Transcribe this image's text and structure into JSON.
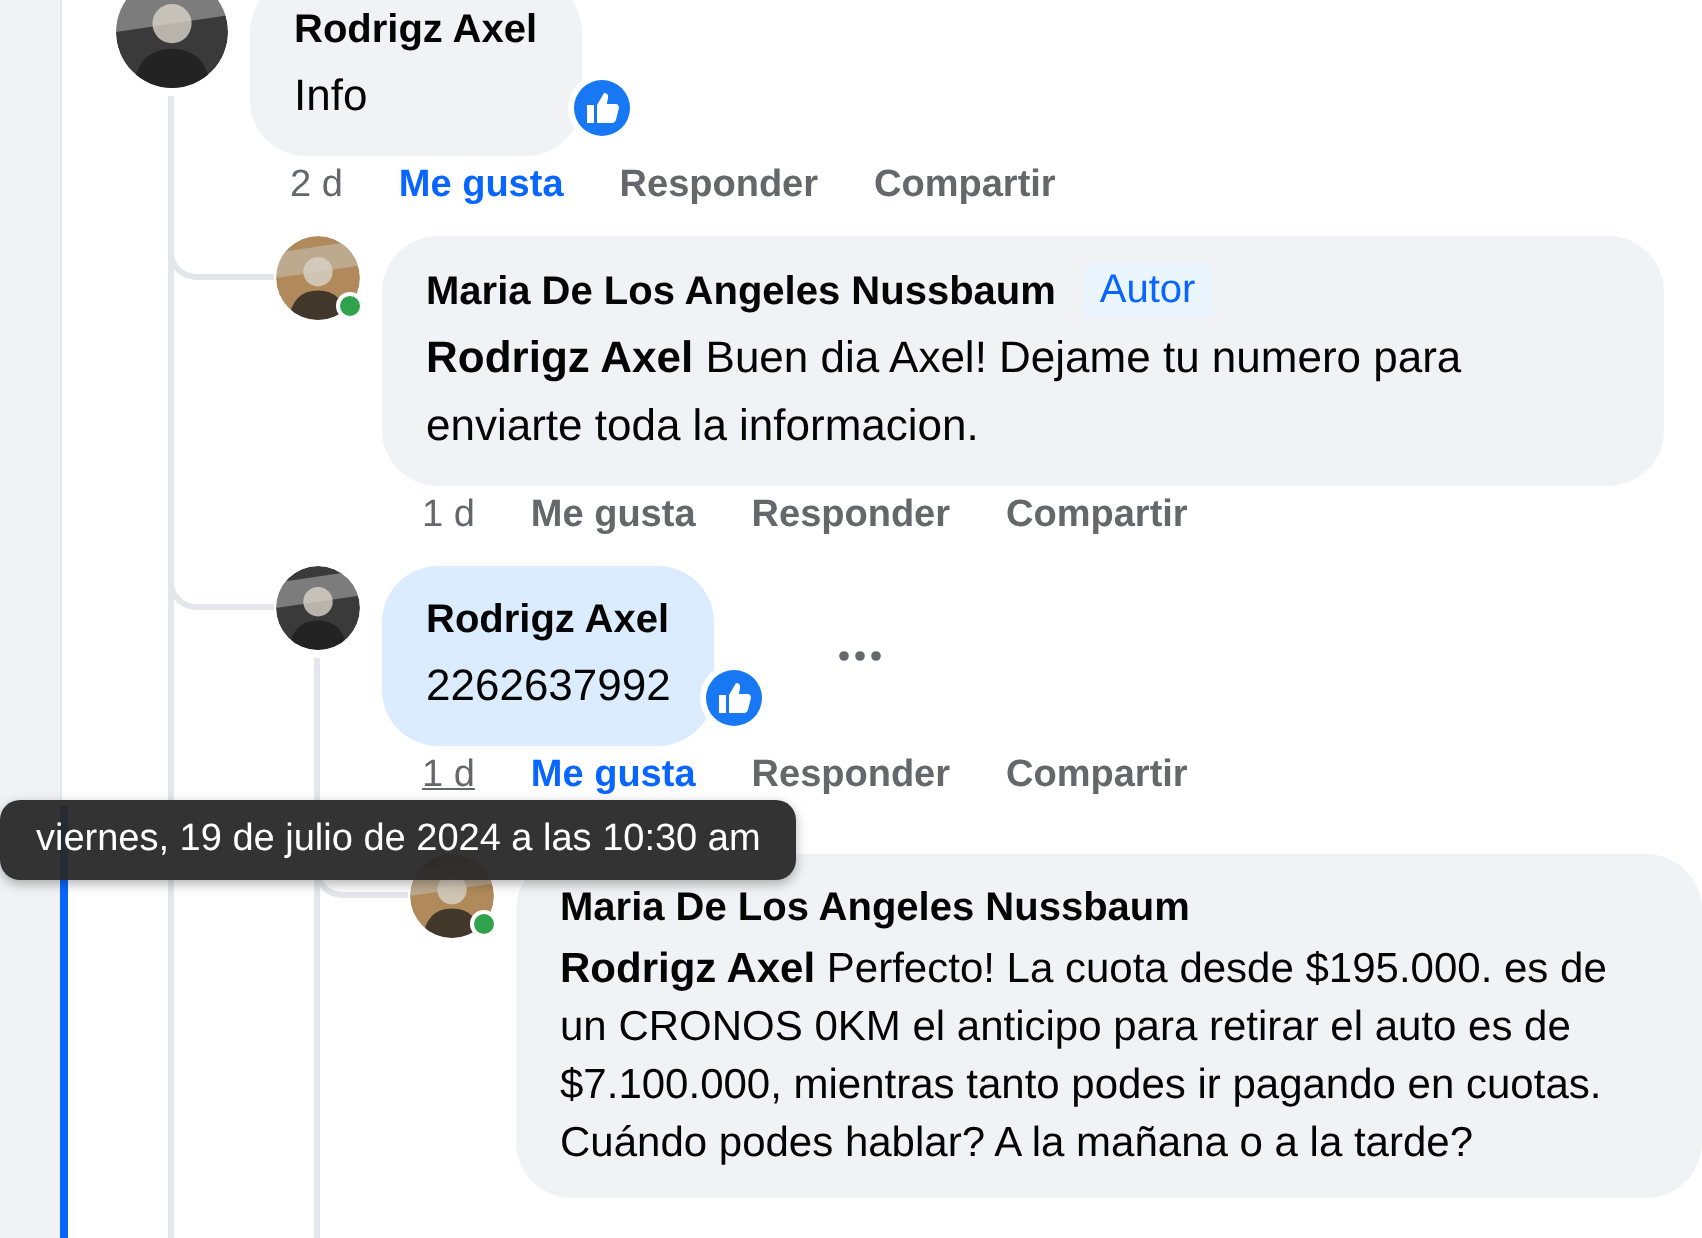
{
  "comments": [
    {
      "author": "Rodrigz Axel",
      "color": "#3a3a3a",
      "online": false,
      "highlighted": false,
      "text": "Info",
      "like_reaction": true,
      "menu": false,
      "time": "2 d",
      "time_hovered": false,
      "actions": [
        {
          "label": "Me gusta",
          "selected": true
        },
        {
          "label": "Responder",
          "selected": false
        },
        {
          "label": "Compartir",
          "selected": false
        }
      ],
      "replies": [
        {
          "author": "Maria De Los Angeles Nussbaum",
          "badge": "Autor",
          "color": "#b08a5a",
          "online": true,
          "highlighted": false,
          "text": "**Rodrigz Axel** Buen dia Axel! Dejame tu numero para enviarte toda la informacion.",
          "like_reaction": false,
          "menu": false,
          "time": "1 d",
          "time_hovered": false,
          "actions": [
            {
              "label": "Me gusta",
              "selected": false
            },
            {
              "label": "Responder",
              "selected": false
            },
            {
              "label": "Compartir",
              "selected": false
            }
          ]
        },
        {
          "author": "Rodrigz Axel",
          "color": "#3a3a3a",
          "online": false,
          "highlighted": true,
          "text": "2262637992",
          "like_reaction": true,
          "menu": true,
          "time": "1 d",
          "time_hovered": true,
          "actions": [
            {
              "label": "Me gusta",
              "selected": true
            },
            {
              "label": "Responder",
              "selected": false
            },
            {
              "label": "Compartir",
              "selected": false
            }
          ],
          "replies": [
            {
              "author": "Maria De Los Angeles Nussbaum",
              "color": "#b08a5a",
              "online": true,
              "highlighted": false,
              "text": "**Rodrigz Axel** Perfecto! La cuota desde $195.000. es de un CRONOS 0KM el anticipo para retirar el auto es de $7.100.000, mientras tanto podes ir pagando en cuotas. Cuándo podes hablar? A la mañana o a la tarde?",
              "like_reaction": false,
              "menu": false
            }
          ]
        }
      ]
    }
  ],
  "tooltip": {
    "text": "viernes, 19 de julio de 2024 a las 10:30 am"
  }
}
